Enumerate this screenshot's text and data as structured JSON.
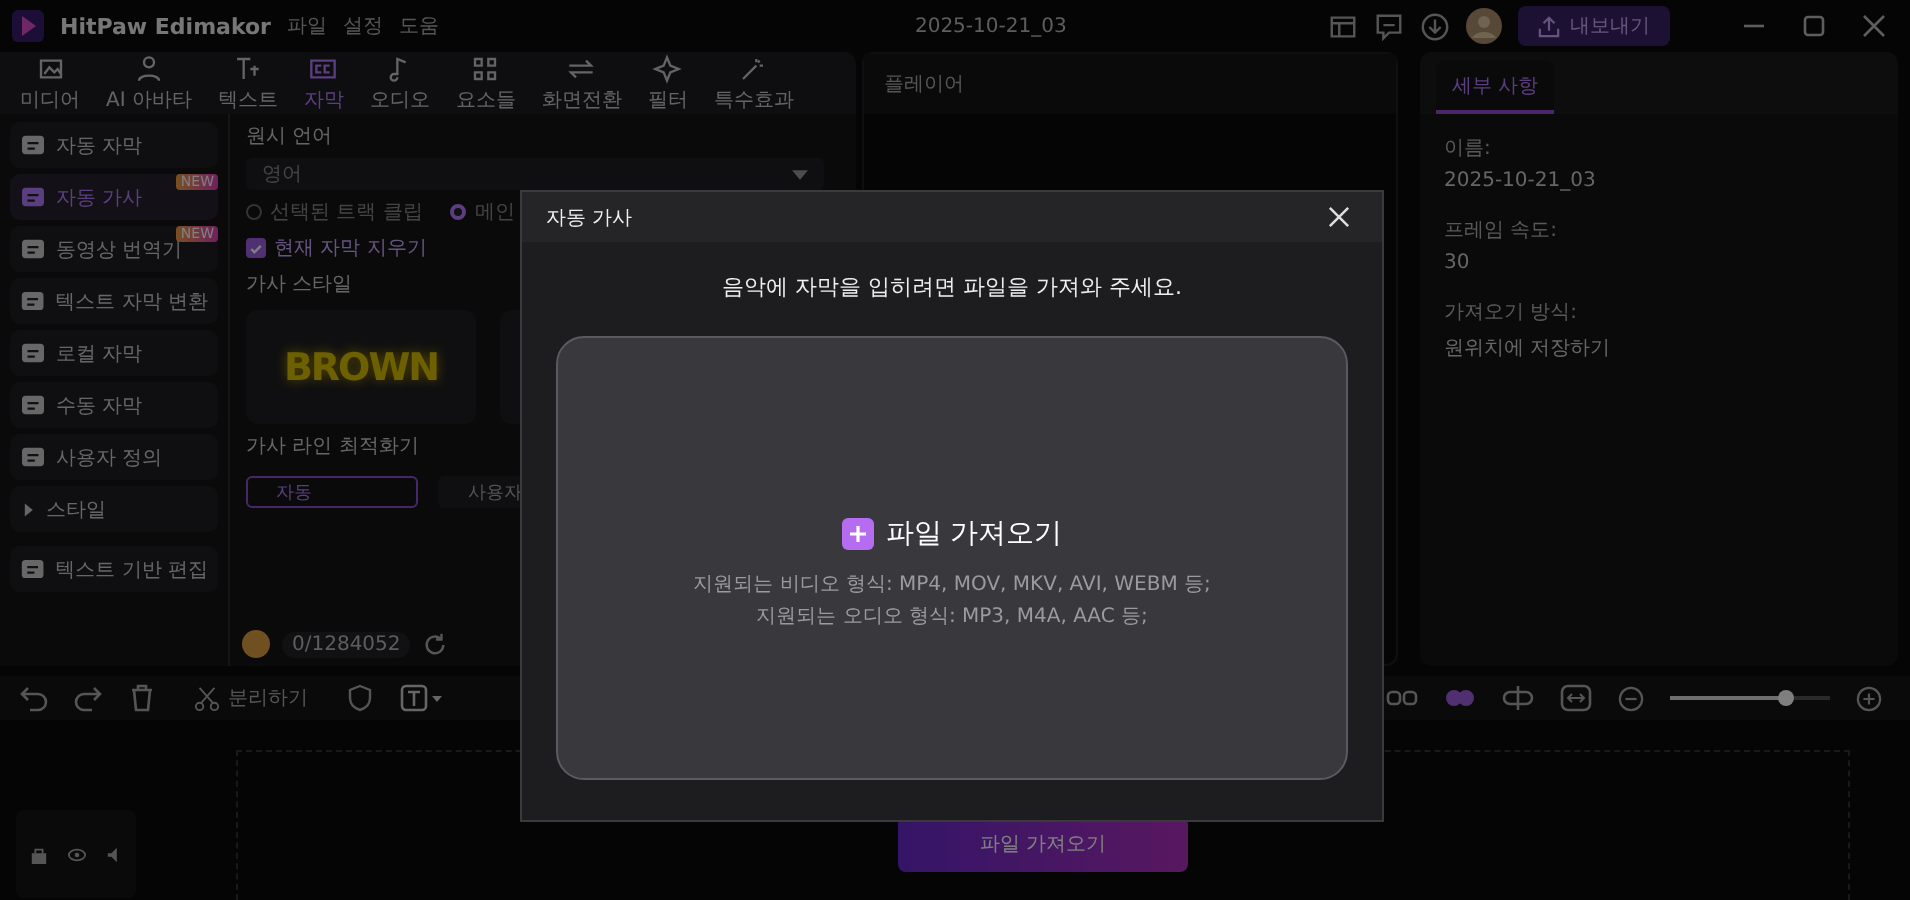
{
  "app": {
    "name": "HitPaw Edimakor",
    "menu": [
      "파일",
      "설정",
      "도움"
    ],
    "project_title": "2025-10-21_03",
    "export_button": "내보내기"
  },
  "toolbar_tabs": [
    {
      "label": "미디어",
      "selected": false
    },
    {
      "label": "AI 아바타",
      "selected": false
    },
    {
      "label": "텍스트",
      "selected": false
    },
    {
      "label": "자막",
      "selected": true
    },
    {
      "label": "오디오",
      "selected": false
    },
    {
      "label": "요소들",
      "selected": false
    },
    {
      "label": "화면전환",
      "selected": false
    },
    {
      "label": "필터",
      "selected": false
    },
    {
      "label": "특수효과",
      "selected": false
    }
  ],
  "sidebar": {
    "items": [
      {
        "label": "자동 자막",
        "selected": false,
        "kind": "item"
      },
      {
        "label": "자동 가사",
        "selected": true,
        "badge": "NEW",
        "kind": "item"
      },
      {
        "label": "동영상 번역기",
        "selected": false,
        "badge": "NEW",
        "kind": "item"
      },
      {
        "label": "텍스트 자막 변환",
        "selected": false,
        "kind": "item"
      },
      {
        "label": "로컬 자막",
        "selected": false,
        "kind": "item"
      },
      {
        "label": "수동 자막",
        "selected": false,
        "kind": "item"
      },
      {
        "label": "사용자 정의",
        "selected": false,
        "kind": "item"
      },
      {
        "label": "스타일",
        "selected": false,
        "kind": "group",
        "expanded": false
      },
      {
        "label": "텍스트 기반 편집",
        "selected": false,
        "kind": "item"
      }
    ]
  },
  "settings": {
    "language_label": "원시 언어",
    "language_value": "영어",
    "scope_options": [
      {
        "label": "선택된 트랙 클립",
        "selected": false
      },
      {
        "label": "메인",
        "selected": true
      }
    ],
    "clear_checkbox": {
      "label": "현재 자막 지우기",
      "checked": true
    },
    "style_label": "가사 스타일",
    "style_cards": [
      {
        "text": "BROWN",
        "selected": false
      }
    ],
    "optimizer_label": "가사 라인 최적화기",
    "optimizer_options": [
      {
        "label": "자동",
        "selected": true
      },
      {
        "label": "사용자",
        "selected": false
      }
    ],
    "credits": "0/1284052"
  },
  "player": {
    "title": "플레이어"
  },
  "details": {
    "tab": "세부 사항",
    "fields": [
      {
        "label": "이름:",
        "value": "2025-10-21_03"
      },
      {
        "label": "프레임 속도:",
        "value": "30"
      },
      {
        "label": "가져오기 방식:",
        "value": "원위치에 저장하기"
      }
    ]
  },
  "timeline": {
    "split_button": "분리하기",
    "zoom": {
      "level": 0.72
    },
    "import_button": "파일 가져오기"
  },
  "dialog": {
    "title": "자동 가사",
    "message": "음악에 자막을 입히려면 파일을 가져와 주세요.",
    "import_button": "파일 가져오기",
    "video_formats": "지원되는 비디오 형식: MP4, MOV, MKV, AVI, WEBM 등;",
    "audio_formats": "지원되는 오디오 형식: MP3, M4A, AAC 등;"
  }
}
